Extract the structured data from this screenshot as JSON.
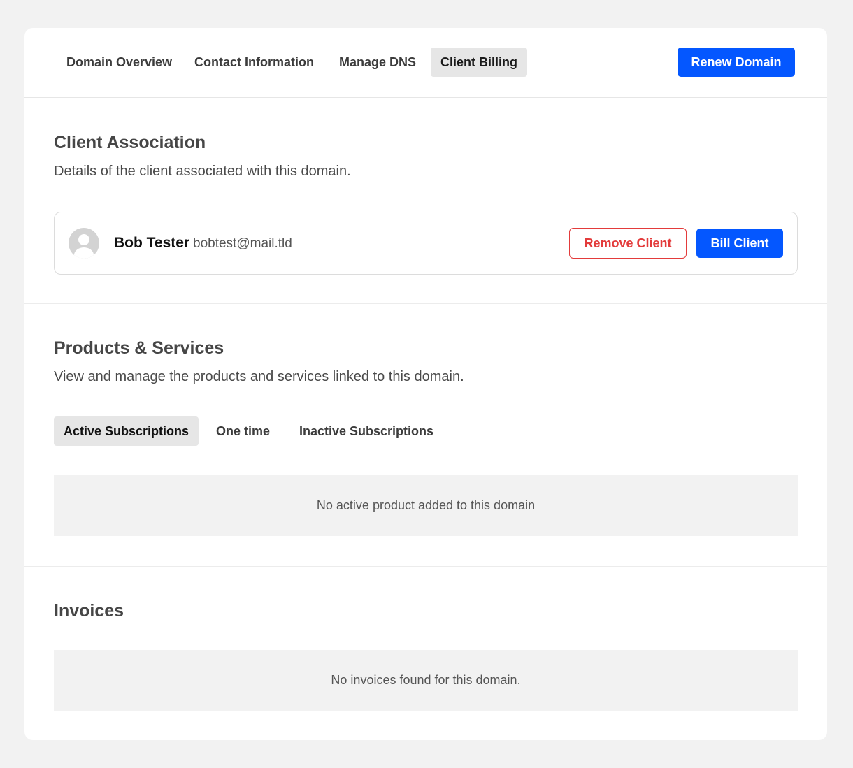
{
  "nav": {
    "tabs": [
      {
        "label": "Domain Overview"
      },
      {
        "label": "Contact Information"
      },
      {
        "label": "Manage DNS"
      },
      {
        "label": "Client Billing",
        "active": true
      }
    ],
    "renew_label": "Renew Domain"
  },
  "client_section": {
    "title": "Client Association",
    "description": "Details of the client associated with this domain.",
    "client": {
      "name": "Bob Tester",
      "email": "bobtest@mail.tld",
      "avatar_icon": "user-avatar-icon"
    },
    "remove_label": "Remove Client",
    "bill_label": "Bill Client"
  },
  "products_section": {
    "title": "Products & Services",
    "description": "View and manage the products and services linked to this domain.",
    "tabs": [
      {
        "label": "Active Subscriptions",
        "active": true
      },
      {
        "label": "One time"
      },
      {
        "label": "Inactive Subscriptions"
      }
    ],
    "empty_message": "No active product added to this domain"
  },
  "invoices_section": {
    "title": "Invoices",
    "empty_message": "No invoices found for this domain."
  },
  "colors": {
    "primary": "#0457ff",
    "danger": "#e33b3b",
    "page_bg": "#f2f2f2"
  }
}
